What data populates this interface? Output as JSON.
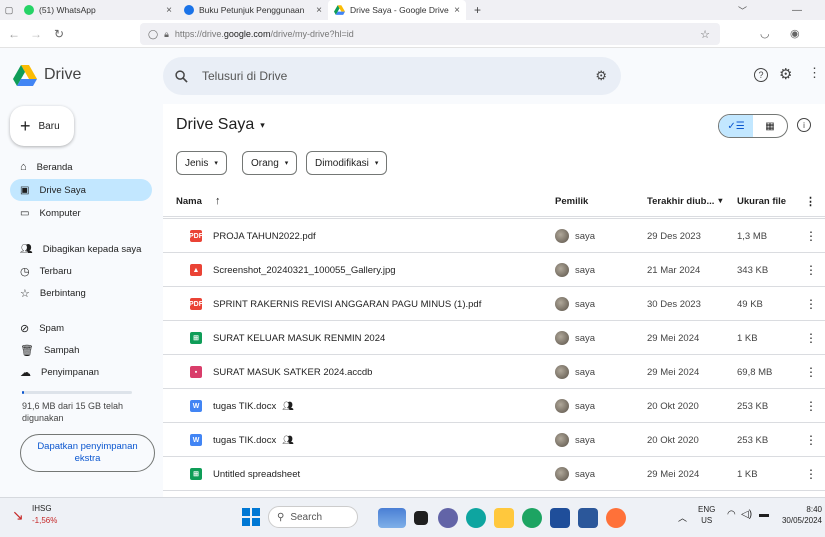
{
  "browser": {
    "tabs": [
      {
        "label": "(51) WhatsApp",
        "close": "×"
      },
      {
        "label": "Buku Petunjuk Penggunaan Go",
        "close": "×"
      },
      {
        "label": "Drive Saya - Google Drive",
        "close": "×"
      }
    ],
    "new_tab": "+",
    "url_prefix": "https://drive.",
    "url_domain": "google.com",
    "url_path": "/drive/my-drive?hl=id"
  },
  "drive": {
    "app_name": "Drive",
    "search_placeholder": "Telusuri di Drive",
    "new_label": "Baru",
    "nav": [
      {
        "label": "Beranda"
      },
      {
        "label": "Drive Saya"
      },
      {
        "label": "Komputer"
      },
      {
        "label": "Dibagikan kepada saya"
      },
      {
        "label": "Terbaru"
      },
      {
        "label": "Berbintang"
      },
      {
        "label": "Spam"
      },
      {
        "label": "Sampah"
      },
      {
        "label": "Penyimpanan"
      }
    ],
    "storage_text": "91,6 MB dari 15 GB telah digunakan",
    "storage_fraction": 0.006,
    "get_storage": "Dapatkan penyimpanan ekstra",
    "page_title": "Drive Saya",
    "filters": [
      "Jenis",
      "Orang",
      "Dimodifikasi"
    ],
    "columns": {
      "name": "Nama",
      "owner": "Pemilik",
      "modified": "Terakhir diub...",
      "size": "Ukuran file"
    },
    "files": [
      {
        "name": "PROJA TAHUN2022.pdf",
        "type": "pdf",
        "owner": "saya",
        "modified": "29 Des 2023",
        "size": "1,3 MB",
        "shared": false
      },
      {
        "name": "Screenshot_20240321_100055_Gallery.jpg",
        "type": "image",
        "owner": "saya",
        "modified": "21 Mar 2024",
        "size": "343 KB",
        "shared": false
      },
      {
        "name": "SPRINT RAKERNIS REVISI ANGGARAN PAGU MINUS (1).pdf",
        "type": "pdf",
        "owner": "saya",
        "modified": "30 Des 2023",
        "size": "49 KB",
        "shared": false
      },
      {
        "name": "SURAT KELUAR MASUK RENMIN 2024",
        "type": "sheet",
        "owner": "saya",
        "modified": "29 Mei 2024",
        "size": "1 KB",
        "shared": false
      },
      {
        "name": "SURAT MASUK SATKER 2024.accdb",
        "type": "access",
        "owner": "saya",
        "modified": "29 Mei 2024",
        "size": "69,8 MB",
        "shared": false
      },
      {
        "name": "tugas TIK.docx",
        "type": "word",
        "owner": "saya",
        "modified": "20 Okt 2020",
        "size": "253 KB",
        "shared": true
      },
      {
        "name": "tugas TIK.docx",
        "type": "word",
        "owner": "saya",
        "modified": "20 Okt 2020",
        "size": "253 KB",
        "shared": true
      },
      {
        "name": "Untitled spreadsheet",
        "type": "sheet",
        "owner": "saya",
        "modified": "29 Mei 2024",
        "size": "1 KB",
        "shared": false
      }
    ]
  },
  "taskbar": {
    "stock_name": "IHSG",
    "stock_change": "-1,56%",
    "search_label": "Search",
    "lang": "ENG",
    "region": "US",
    "time": "8:40",
    "date": "30/05/2024"
  },
  "colors": {
    "accent": "#c2e7ff",
    "pdf": "#ea4335",
    "sheet": "#0f9d58",
    "word": "#4285f4",
    "access": "#d93d6a"
  }
}
